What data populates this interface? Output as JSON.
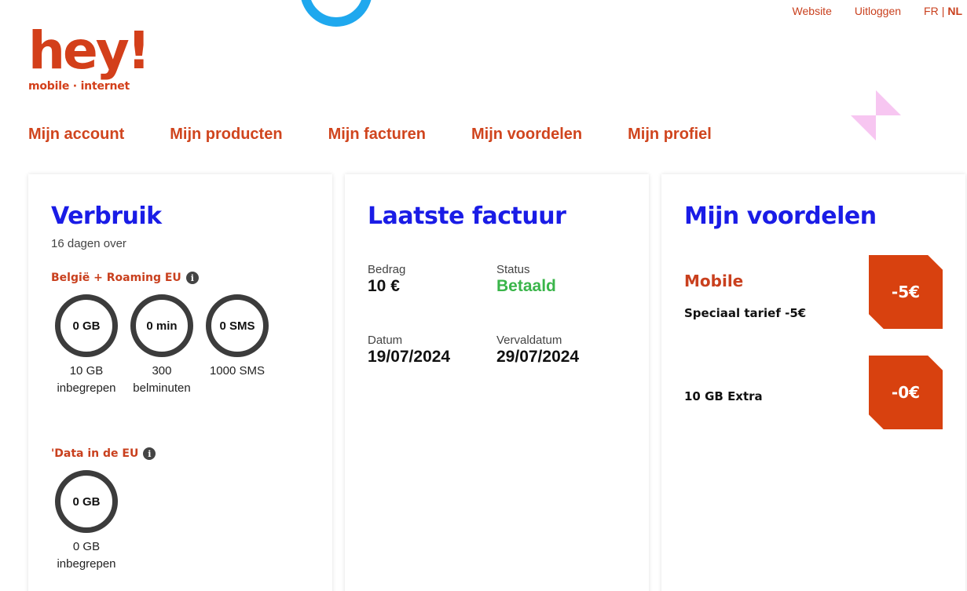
{
  "top_links": {
    "website": "Website",
    "logout": "Uitloggen",
    "lang_fr": "FR",
    "separator": "|",
    "lang_nl": "NL"
  },
  "logo": {
    "main": "hey!",
    "sub": "mobile · internet"
  },
  "nav": [
    {
      "label": "Mijn account"
    },
    {
      "label": "Mijn producten"
    },
    {
      "label": "Mijn facturen"
    },
    {
      "label": "Mijn voordelen"
    },
    {
      "label": "Mijn profiel"
    }
  ],
  "usage": {
    "title": "Verbruik",
    "days_left": "16 dagen over",
    "section1": {
      "label": "België + Roaming EU",
      "meters": [
        {
          "value": "0 GB",
          "caption1": "10 GB",
          "caption2": "inbegrepen"
        },
        {
          "value": "0 min",
          "caption1": "300",
          "caption2": "belminuten"
        },
        {
          "value": "0 SMS",
          "caption1": "1000 SMS",
          "caption2": ""
        }
      ]
    },
    "section2": {
      "label": "'Data in de EU",
      "meters": [
        {
          "value": "0 GB",
          "caption1": "0 GB",
          "caption2": "inbegrepen"
        }
      ]
    },
    "info_glyph": "i"
  },
  "invoice": {
    "title": "Laatste factuur",
    "amount_label": "Bedrag",
    "amount_value": "10 €",
    "status_label": "Status",
    "status_value": "Betaald",
    "date_label": "Datum",
    "date_value": "19/07/2024",
    "due_label": "Vervaldatum",
    "due_value": "29/07/2024"
  },
  "benefits": {
    "title": "Mijn voordelen",
    "items": [
      {
        "category": "Mobile",
        "name": "Speciaal tarief -5€",
        "badge": "-5€"
      },
      {
        "category": "",
        "name": "10 GB Extra",
        "badge": "-0€"
      }
    ]
  },
  "colors": {
    "brand_orange": "#d33f1a",
    "title_blue": "#1a1ce6",
    "paid_green": "#3ab54a",
    "decor_blue": "#1fa8ee",
    "decor_pink": "#f7c6f1"
  }
}
